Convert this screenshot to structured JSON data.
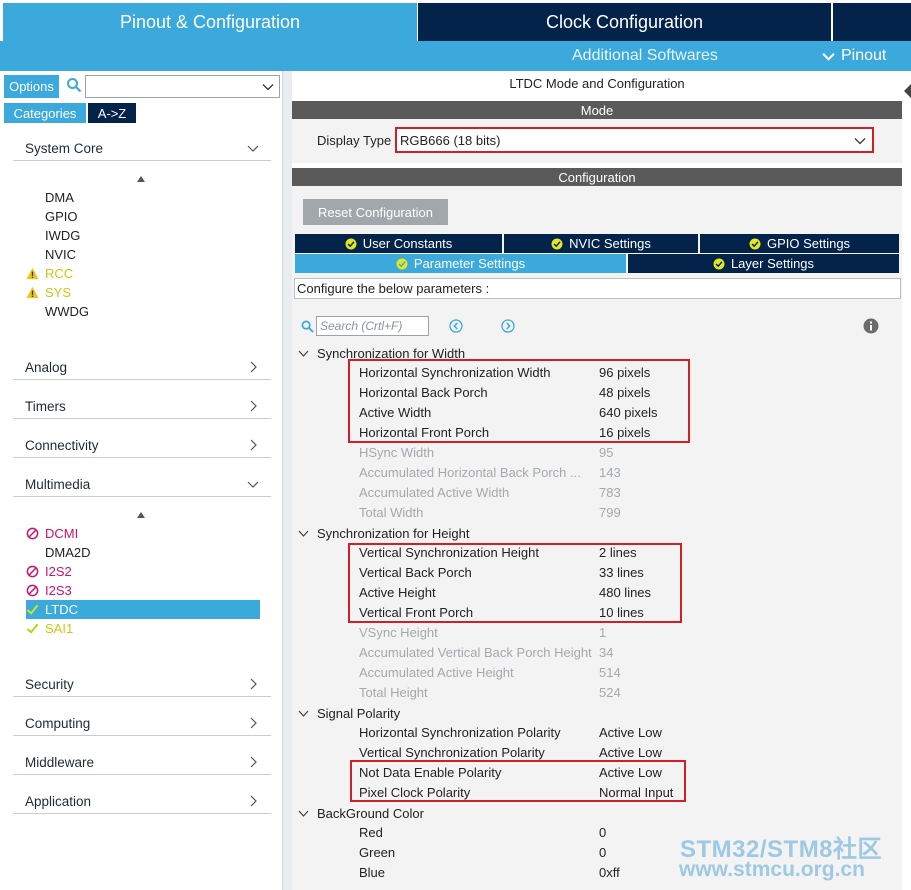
{
  "tabs": {
    "pinout": "Pinout & Configuration",
    "clock": "Clock Configuration",
    "additional": "Additional Softwares",
    "pinout_menu": "Pinout"
  },
  "left": {
    "options_label": "Options",
    "categories_label": "Categories",
    "az_label": "A->Z",
    "system_core": {
      "label": "System Core",
      "items": [
        {
          "label": "DMA",
          "status": "none"
        },
        {
          "label": "GPIO",
          "status": "none"
        },
        {
          "label": "IWDG",
          "status": "none"
        },
        {
          "label": "NVIC",
          "status": "none"
        },
        {
          "label": "RCC",
          "status": "warning"
        },
        {
          "label": "SYS",
          "status": "warning"
        },
        {
          "label": "WWDG",
          "status": "none"
        }
      ]
    },
    "analog": "Analog",
    "timers": "Timers",
    "connectivity": "Connectivity",
    "multimedia": {
      "label": "Multimedia",
      "items": [
        {
          "label": "DCMI",
          "status": "disabled"
        },
        {
          "label": "DMA2D",
          "status": "none"
        },
        {
          "label": "I2S2",
          "status": "disabled"
        },
        {
          "label": "I2S3",
          "status": "disabled"
        },
        {
          "label": "LTDC",
          "status": "selected"
        },
        {
          "label": "SAI1",
          "status": "ok"
        }
      ]
    },
    "security": "Security",
    "computing": "Computing",
    "middleware": "Middleware",
    "application": "Application"
  },
  "right": {
    "title": "LTDC Mode and Configuration",
    "mode_label": "Mode",
    "display_type_label": "Display Type",
    "display_type_value": "RGB666 (18 bits)",
    "configuration_label": "Configuration",
    "reset_button": "Reset Configuration",
    "tabs_row1": [
      "User Constants",
      "NVIC Settings",
      "GPIO Settings"
    ],
    "tabs_row2": [
      "Parameter Settings",
      "Layer Settings"
    ],
    "hint": "Configure the below parameters :",
    "search_placeholder": "Search (Crtl+F)",
    "groups": [
      {
        "name": "Synchronization for Width",
        "params": [
          {
            "name": "Horizontal Synchronization Width",
            "value": "96 pixels",
            "editable": true
          },
          {
            "name": "Horizontal Back Porch",
            "value": "48 pixels",
            "editable": true
          },
          {
            "name": "Active Width",
            "value": "640 pixels",
            "editable": true
          },
          {
            "name": "Horizontal Front Porch",
            "value": "16 pixels",
            "editable": true
          },
          {
            "name": "HSync Width",
            "value": "95",
            "editable": false
          },
          {
            "name": "Accumulated Horizontal Back Porch ...",
            "value": "143",
            "editable": false
          },
          {
            "name": "Accumulated Active Width",
            "value": "783",
            "editable": false
          },
          {
            "name": "Total Width",
            "value": "799",
            "editable": false
          }
        ]
      },
      {
        "name": "Synchronization for Height",
        "params": [
          {
            "name": "Vertical Synchronization Height",
            "value": "2 lines",
            "editable": true
          },
          {
            "name": "Vertical Back Porch",
            "value": "33 lines",
            "editable": true
          },
          {
            "name": "Active Height",
            "value": "480 lines",
            "editable": true
          },
          {
            "name": "Vertical Front Porch",
            "value": "10 lines",
            "editable": true
          },
          {
            "name": "VSync Height",
            "value": "1",
            "editable": false
          },
          {
            "name": "Accumulated Vertical Back Porch Height",
            "value": "34",
            "editable": false
          },
          {
            "name": "Accumulated Active Height",
            "value": "514",
            "editable": false
          },
          {
            "name": "Total Height",
            "value": "524",
            "editable": false
          }
        ]
      },
      {
        "name": "Signal Polarity",
        "params": [
          {
            "name": "Horizontal Synchronization Polarity",
            "value": "Active Low",
            "editable": true
          },
          {
            "name": "Vertical Synchronization Polarity",
            "value": "Active Low",
            "editable": true
          },
          {
            "name": "Not Data Enable Polarity",
            "value": "Active Low",
            "editable": true
          },
          {
            "name": "Pixel Clock Polarity",
            "value": "Normal Input",
            "editable": true
          }
        ]
      },
      {
        "name": "BackGround Color",
        "params": [
          {
            "name": "Red",
            "value": "0",
            "editable": true
          },
          {
            "name": "Green",
            "value": "0",
            "editable": true
          },
          {
            "name": "Blue",
            "value": "0xff",
            "editable": true
          }
        ]
      }
    ]
  },
  "watermark": {
    "line1": "STM32/STM8社区",
    "line2": "www.stmcu.org.cn"
  },
  "colors": {
    "accent_blue": "#3ba9db",
    "dark_navy": "#03234b",
    "highlight_red": "#d11f26",
    "warning_yellow": "#c9c912",
    "disabled_magenta": "#c8136c"
  }
}
